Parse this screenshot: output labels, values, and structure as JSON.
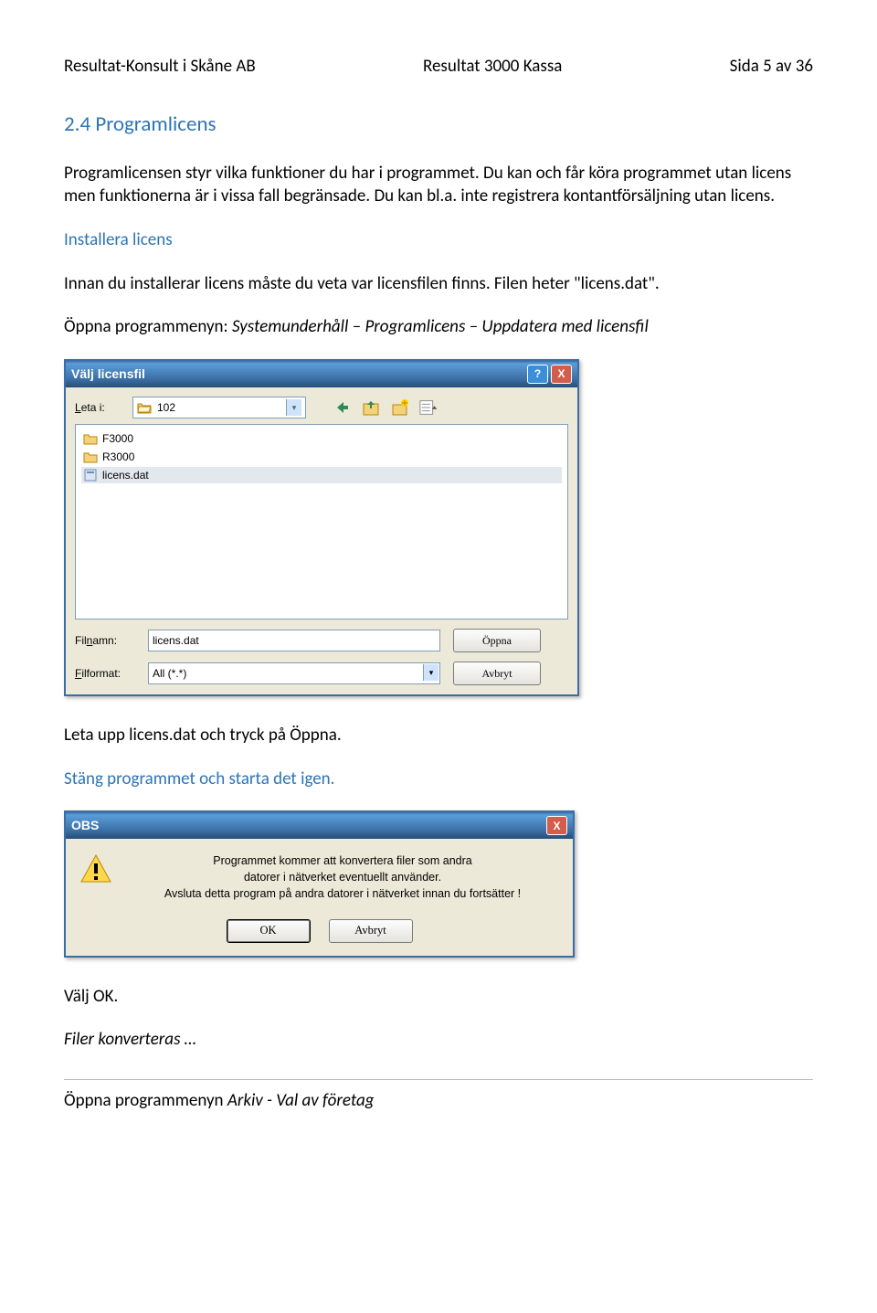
{
  "header": {
    "left": "Resultat-Konsult i Skåne AB",
    "center": "Resultat 3000 Kassa",
    "right": "Sida 5 av 36"
  },
  "section_heading": "2.4 Programlicens",
  "para1": "Programlicensen styr vilka funktioner du har i programmet. Du kan och får köra programmet utan licens men funktionerna är i vissa fall begränsade. Du kan bl.a. inte registrera kontantförsäljning utan licens.",
  "sub_blue_1": "Installera licens",
  "para2": "Innan du installerar licens måste du veta var licensfilen finns. Filen heter \"licens.dat\".",
  "para3_prefix": "Öppna programmenyn: ",
  "para3_italic": "Systemunderhåll – Programlicens – Uppdatera med licensfil",
  "dialog1": {
    "title": "Välj licensfil",
    "help_label": "?",
    "close_label": "X",
    "look_in_label": "Leta i:",
    "current_folder": "102",
    "folders": [
      "F3000",
      "R3000"
    ],
    "selected_file": "licens.dat",
    "filename_label": "Filnamn:",
    "filename_value": "licens.dat",
    "filetype_label": "Filformat:",
    "filetype_value": "All (*.*)",
    "open_btn": "Öppna",
    "cancel_btn": "Avbryt"
  },
  "para4": "Leta upp licens.dat och tryck på Öppna.",
  "sub_blue_2": "Stäng programmet och starta det igen.",
  "dialog2": {
    "title": "OBS",
    "close_label": "X",
    "line1": "Programmet kommer att konvertera filer som andra",
    "line2": "datorer i nätverket eventuellt använder.",
    "line3": "Avsluta detta program på andra datorer i nätverket innan du fortsätter !",
    "ok_btn": "OK",
    "cancel_btn": "Avbryt"
  },
  "para5": "Välj OK.",
  "para6_italic": "Filer konverteras …",
  "para7_prefix": "Öppna programmenyn ",
  "para7_italic": "Arkiv - Val av företag"
}
